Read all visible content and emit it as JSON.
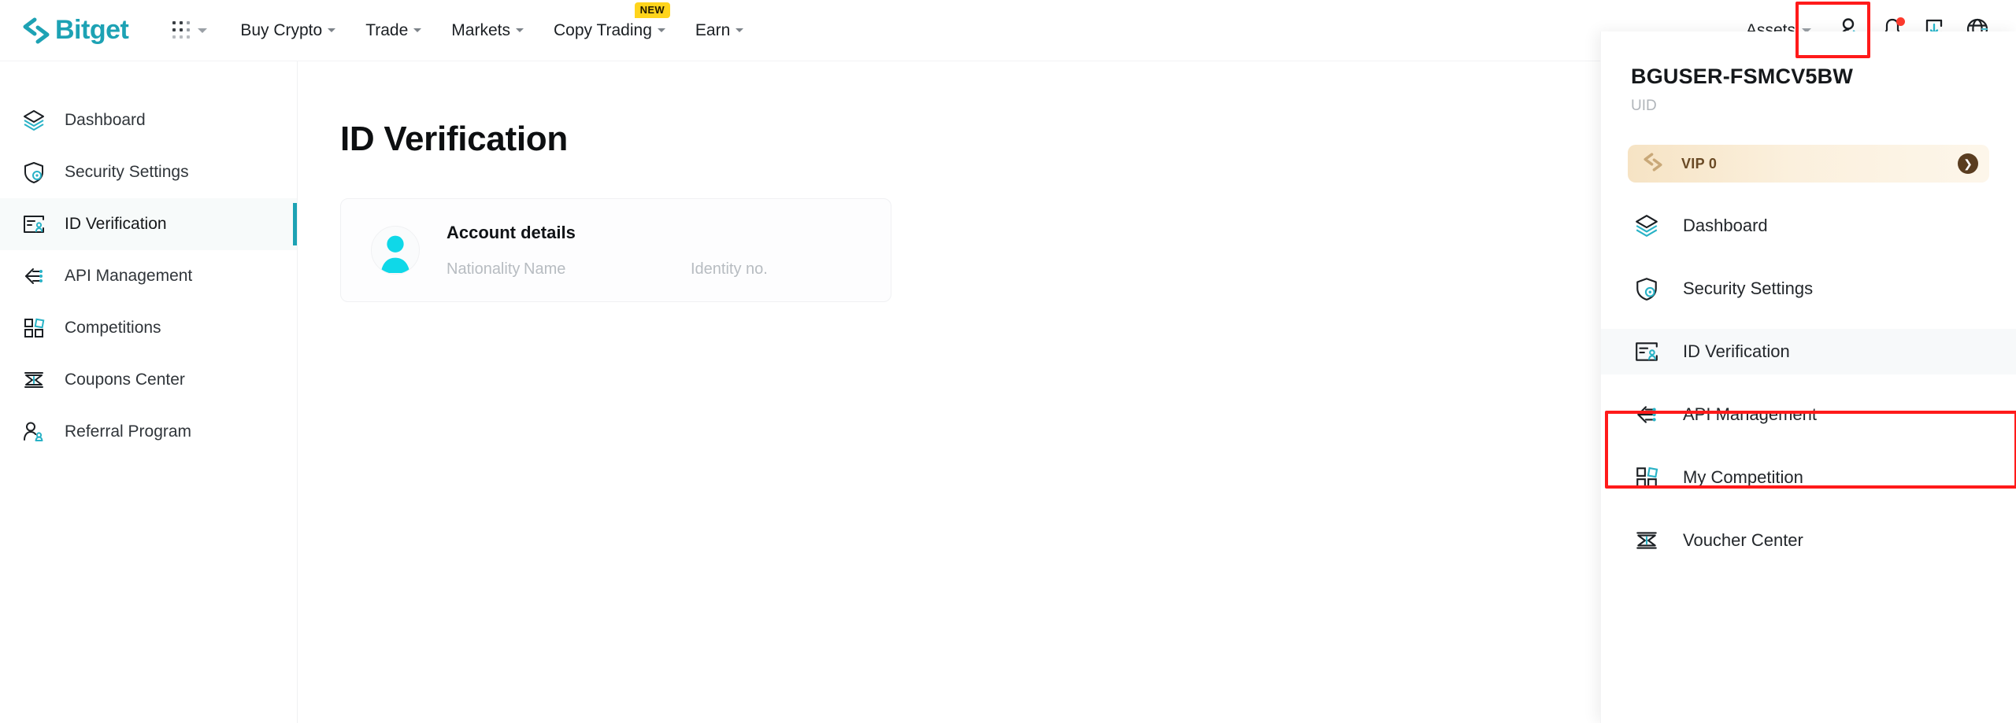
{
  "header": {
    "brand": "Bitget",
    "logo_color": "#1da2b4",
    "apps_grid_icon": "apps-grid-icon",
    "nav_items": [
      {
        "label": "Buy Crypto",
        "has_caret": true,
        "badge": ""
      },
      {
        "label": "Trade",
        "has_caret": true,
        "badge": ""
      },
      {
        "label": "Markets",
        "has_caret": true,
        "badge": ""
      },
      {
        "label": "Copy Trading",
        "has_caret": true,
        "badge": "NEW"
      },
      {
        "label": "Earn",
        "has_caret": true,
        "badge": ""
      }
    ],
    "assets_label": "Assets",
    "icons": [
      {
        "name": "profile-icon",
        "highlighted": true
      },
      {
        "name": "notification-bell-icon",
        "has_dot": true
      },
      {
        "name": "download-app-icon",
        "has_dot": false
      },
      {
        "name": "language-globe-icon",
        "has_dot": false
      }
    ],
    "new_badge_color": "#ffd41c",
    "highlight_color": "#ff1a1a"
  },
  "sidebar": {
    "items": [
      {
        "label": "Dashboard",
        "icon": "layers-icon",
        "active": false
      },
      {
        "label": "Security Settings",
        "icon": "shield-icon",
        "active": false
      },
      {
        "label": "ID Verification",
        "icon": "id-card-icon",
        "active": true
      },
      {
        "label": "API Management",
        "icon": "api-arrow-icon",
        "active": false
      },
      {
        "label": "Competitions",
        "icon": "grid-squares-icon",
        "active": false
      },
      {
        "label": "Coupons Center",
        "icon": "ticket-icon",
        "active": false
      },
      {
        "label": "Referral Program",
        "icon": "user-referral-icon",
        "active": false
      }
    ],
    "active_indicator_color": "#1da2b4"
  },
  "main": {
    "page_title": "ID Verification",
    "card": {
      "avatar_icon": "user-avatar-icon",
      "avatar_color": "#0fd8e8",
      "title": "Account details",
      "fields": [
        {
          "label": "Nationality",
          "value": ""
        },
        {
          "label": "Name",
          "value": ""
        },
        {
          "label": "Identity no.",
          "value": ""
        }
      ]
    }
  },
  "dropdown": {
    "username": "BGUSER-FSMCV5BW",
    "uid_label": "UID",
    "vip": {
      "icon": "bitget-vip-icon",
      "label": "VIP 0",
      "arrow_icon": "chevron-right-icon"
    },
    "items": [
      {
        "label": "Dashboard",
        "icon": "layers-icon",
        "highlighted": false
      },
      {
        "label": "Security Settings",
        "icon": "shield-icon",
        "highlighted": false
      },
      {
        "label": "ID Verification",
        "icon": "id-card-icon",
        "highlighted": true
      },
      {
        "label": "API Management",
        "icon": "api-arrow-icon",
        "highlighted": false
      },
      {
        "label": "My Competition",
        "icon": "grid-squares-icon",
        "highlighted": false
      },
      {
        "label": "Voucher Center",
        "icon": "ticket-icon",
        "highlighted": false
      }
    ]
  }
}
